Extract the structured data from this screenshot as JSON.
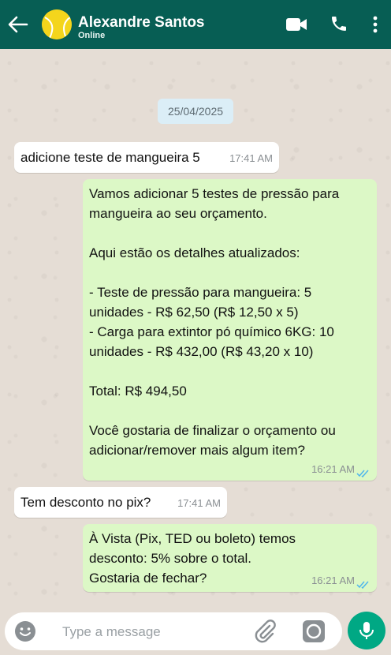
{
  "header": {
    "contact_name": "Alexandre Santos",
    "status": "Online"
  },
  "chat": {
    "date": "25/04/2025",
    "messages": [
      {
        "direction": "in",
        "text": "adicione teste de mangueira 5",
        "time": "17:41 AM"
      },
      {
        "direction": "out",
        "text": "Vamos adicionar 5 testes de pressão para\nmangueira ao seu orçamento.\n\nAqui estão os detalhes atualizados:\n\n- Teste de pressão para mangueira: 5\nunidades - R$ 62,50 (R$ 12,50 x 5)\n- Carga para extintor pó químico 6KG: 10\nunidades - R$ 432,00 (R$ 43,20 x 10)\n\nTotal: R$ 494,50\n\nVocê gostaria de finalizar o orçamento ou\nadicionar/remover mais algum item?",
        "time": "16:21 AM",
        "status": "read"
      },
      {
        "direction": "in",
        "text": "Tem desconto no pix?",
        "time": "17:41 AM"
      },
      {
        "direction": "out",
        "text": "À Vista (Pix, TED ou boleto) temos\ndesconto: 5% sobre o total.\nGostaria de fechar?",
        "time": "16:21 AM",
        "status": "read"
      }
    ]
  },
  "composer": {
    "placeholder": "Type a message"
  },
  "colors": {
    "header": "#075e54",
    "outgoing_bubble": "#dcf8c6",
    "incoming_bubble": "#ffffff",
    "chat_background": "#e5ddd5",
    "mic_button": "#00a884",
    "read_ticks": "#4fb6ec"
  },
  "icons": [
    "back-arrow-icon",
    "avatar-ball",
    "video-call-icon",
    "phone-icon",
    "more-options-icon",
    "emoji-icon",
    "attach-icon",
    "camera-icon",
    "mic-icon",
    "double-check-icon"
  ]
}
